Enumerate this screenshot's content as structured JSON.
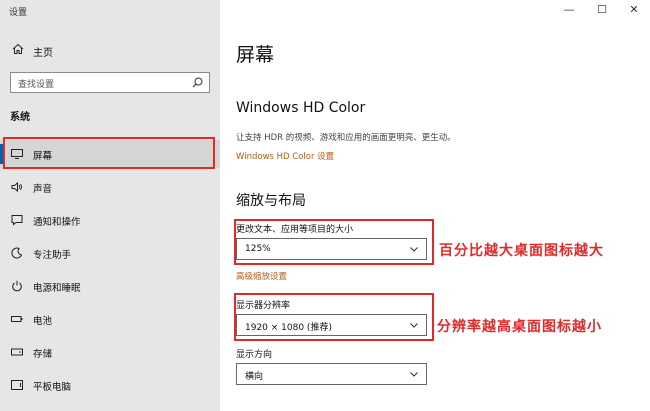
{
  "window": {
    "title": "设置",
    "minimize": "—",
    "maximize": "☐",
    "close": "✕"
  },
  "sidebar": {
    "home_label": "主页",
    "search_placeholder": "查找设置",
    "section_title": "系统",
    "items": [
      {
        "label": "屏幕",
        "icon": "monitor-icon",
        "active": true
      },
      {
        "label": "声音",
        "icon": "speaker-icon"
      },
      {
        "label": "通知和操作",
        "icon": "notification-icon"
      },
      {
        "label": "专注助手",
        "icon": "moon-icon"
      },
      {
        "label": "电源和睡眠",
        "icon": "power-icon"
      },
      {
        "label": "电池",
        "icon": "battery-icon"
      },
      {
        "label": "存储",
        "icon": "storage-icon"
      },
      {
        "label": "平板电脑",
        "icon": "tablet-icon"
      }
    ]
  },
  "main": {
    "page_title": "屏幕",
    "hdr": {
      "title": "Windows HD Color",
      "description": "让支持 HDR 的视频、游戏和应用的画面更明亮、更生动。",
      "link": "Windows HD Color 设置"
    },
    "scale_layout": {
      "title": "缩放与布局",
      "text_size_label": "更改文本、应用等项目的大小",
      "text_size_value": "125%",
      "advanced_link": "高级缩放设置",
      "resolution_label": "显示器分辨率",
      "resolution_value": "1920 × 1080 (推荐)",
      "orientation_label": "显示方向",
      "orientation_value": "横向"
    }
  },
  "annotations": {
    "scale_note": "百分比越大桌面图标越大",
    "resolution_note": "分辨率越高桌面图标越小"
  },
  "colors": {
    "accent": "#0063b1",
    "annotation": "#e02a2a",
    "link": "#b55a16",
    "sidebar_bg": "#e6e6e6"
  }
}
